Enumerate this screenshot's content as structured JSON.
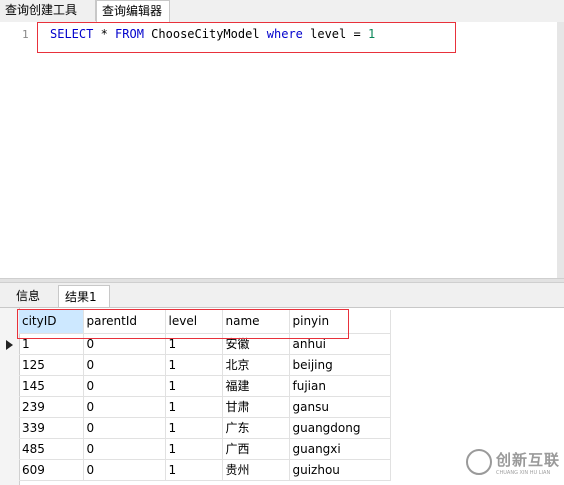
{
  "top_tabs": [
    "查询创建工具",
    "查询编辑器"
  ],
  "editor": {
    "line_number": "1",
    "sql": {
      "select": "SELECT",
      "star": " * ",
      "from": "FROM",
      "table": " ChooseCityModel ",
      "where": "where",
      "cond": " level = ",
      "value": "1"
    }
  },
  "result_tabs": [
    "信息",
    "结果1"
  ],
  "columns": [
    "cityID",
    "parentId",
    "level",
    "name",
    "pinyin"
  ],
  "rows": [
    [
      "1",
      "0",
      "1",
      "安徽",
      "anhui"
    ],
    [
      "125",
      "0",
      "1",
      "北京",
      "beijing"
    ],
    [
      "145",
      "0",
      "1",
      "福建",
      "fujian"
    ],
    [
      "239",
      "0",
      "1",
      "甘肃",
      "gansu"
    ],
    [
      "339",
      "0",
      "1",
      "广东",
      "guangdong"
    ],
    [
      "485",
      "0",
      "1",
      "广西",
      "guangxi"
    ],
    [
      "609",
      "0",
      "1",
      "贵州",
      "guizhou"
    ]
  ],
  "watermark": {
    "text": "创新互联",
    "sub": "CHUANG XIN HU LIAN"
  },
  "colors": {
    "highlight_border": "#e8313b",
    "keyword": "#0000cc",
    "number": "#098658",
    "selected_header": "#cde8ff"
  }
}
